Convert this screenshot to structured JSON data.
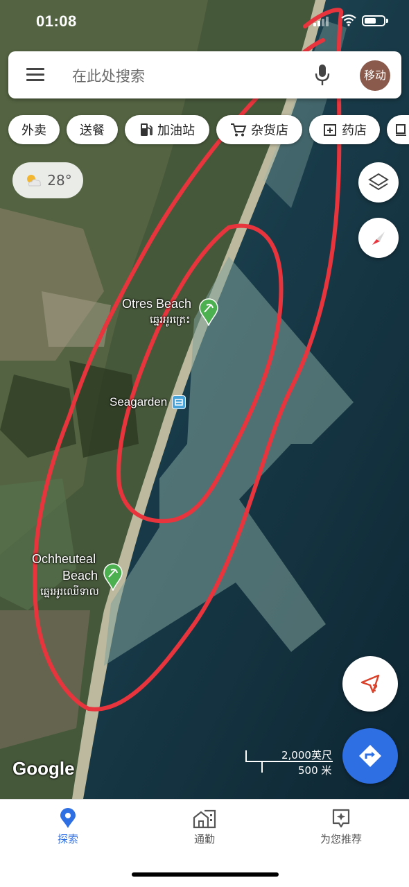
{
  "status_bar": {
    "time": "01:08",
    "battery_level": 0.6
  },
  "search": {
    "placeholder": "在此处搜索",
    "avatar_text": "移动"
  },
  "chips": [
    {
      "label": "外卖",
      "icon": ""
    },
    {
      "label": "送餐",
      "icon": ""
    },
    {
      "label": "加油站",
      "icon": "gas-station-icon"
    },
    {
      "label": "杂货店",
      "icon": "cart-icon"
    },
    {
      "label": "药店",
      "icon": "pharmacy-icon"
    },
    {
      "label": "",
      "icon": "cup-icon"
    }
  ],
  "weather": {
    "temperature": "28°",
    "icon": "partly-cloudy-icon"
  },
  "map": {
    "labels": {
      "otres_en": "Otres Beach",
      "otres_km": "ឆ្នេរអូរត្រេះ",
      "seagarden": "Seagarden",
      "ochheuteal_en_1": "Ochheuteal",
      "ochheuteal_en_2": "Beach",
      "ochheuteal_km": "ឆ្នេរអូរឈើទាល"
    },
    "attribution": "Google",
    "scale": {
      "imperial": "2,000英尺",
      "metric": "500 米"
    },
    "colors": {
      "annotation": "#e8343c",
      "accent": "#2f6fe4",
      "pin": "#4caf50"
    }
  },
  "bottom_nav": [
    {
      "label": "探索",
      "icon": "location-pin-icon",
      "active": true
    },
    {
      "label": "通勤",
      "icon": "commute-buildings-icon",
      "active": false
    },
    {
      "label": "为您推荐",
      "icon": "sparkle-icon",
      "active": false
    }
  ]
}
